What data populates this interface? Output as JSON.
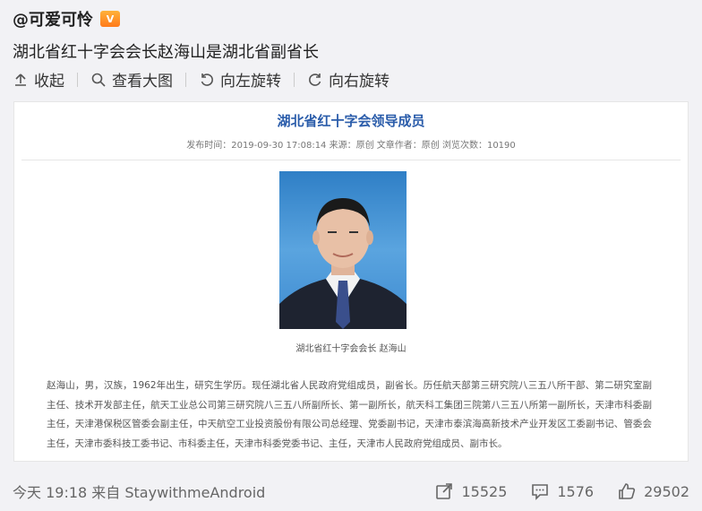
{
  "post": {
    "username": "@可爱可怜",
    "vip_badge": "V",
    "text": "湖北省红十字会会长赵海山是湖北省副省长"
  },
  "toolbar": {
    "collect": "收起",
    "view_large": "查看大图",
    "rotate_left": "向左旋转",
    "rotate_right": "向右旋转"
  },
  "article": {
    "title": "湖北省红十字会领导成员",
    "meta": "发布时间：2019-09-30 17:08:14  来源：原创  文章作者：原创  浏览次数：10190",
    "caption": "湖北省红十字会会长  赵海山",
    "bio": "赵海山，男，汉族，1962年出生，研究生学历。现任湖北省人民政府党组成员，副省长。历任航天部第三研究院八三五八所干部、第二研究室副主任、技术开发部主任，航天工业总公司第三研究院八三五八所副所长、第一副所长，航天科工集团三院第八三五八所第一副所长，天津市科委副主任，天津港保税区管委会副主任，中天航空工业投资股份有限公司总经理、党委副书记，天津市泰滨海高新技术产业开发区工委副书记、管委会主任，天津市委科技工委书记、市科委主任，天津市科委党委书记、主任，天津市人民政府党组成员、副市长。"
  },
  "footer": {
    "time_source": "今天 19:18 来自 StaywithmeAndroid",
    "reposts": "15525",
    "comments": "1576",
    "likes": "29502"
  },
  "colors": {
    "article_title": "#2a5caa",
    "portrait_background": "#3d8ad0"
  }
}
